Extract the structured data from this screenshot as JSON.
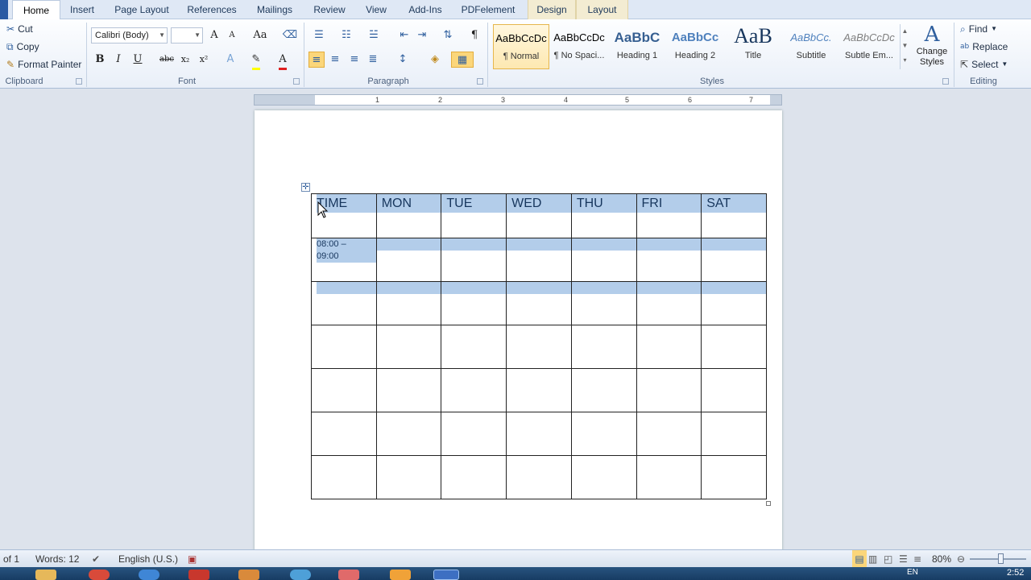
{
  "tabs": [
    "Home",
    "Insert",
    "Page Layout",
    "References",
    "Mailings",
    "Review",
    "View",
    "Add-Ins",
    "PDFelement",
    "Design",
    "Layout"
  ],
  "clipboard": {
    "cut": "Cut",
    "copy": "Copy",
    "format_painter": "Format Painter",
    "label": "Clipboard"
  },
  "font": {
    "name": "Calibri (Body)",
    "size": "",
    "label": "Font",
    "bold": "B",
    "italic": "I",
    "underline": "U",
    "strike": "abc",
    "sub": "x₂",
    "sup": "x²",
    "grow": "A",
    "shrink": "A",
    "case": "Aa"
  },
  "paragraph": {
    "label": "Paragraph",
    "pilcrow": "¶"
  },
  "styles": {
    "label": "Styles",
    "items": [
      {
        "preview": "AaBbCcDc",
        "name": "¶ Normal"
      },
      {
        "preview": "AaBbCcDc",
        "name": "¶ No Spaci..."
      },
      {
        "preview": "AaBbC",
        "name": "Heading 1"
      },
      {
        "preview": "AaBbCc",
        "name": "Heading 2"
      },
      {
        "preview": "AaB",
        "name": "Title"
      },
      {
        "preview": "AaBbCc.",
        "name": "Subtitle"
      },
      {
        "preview": "AaBbCcDc",
        "name": "Subtle Em..."
      }
    ],
    "change_styles_line1": "Change",
    "change_styles_line2": "Styles"
  },
  "editing": {
    "label": "Editing",
    "find": "Find",
    "replace": "Replace",
    "select": "Select"
  },
  "ruler": {
    "numbers": [
      "1",
      "2",
      "3",
      "4",
      "5",
      "6",
      "7"
    ]
  },
  "table": {
    "headers": [
      "TIME",
      "MON",
      "TUE",
      "WED",
      "THU",
      "FRI",
      "SAT"
    ],
    "time_line1": "08:00 –",
    "time_line2": "09:00"
  },
  "status": {
    "page": "of 1",
    "words": "Words: 12",
    "language": "English (U.S.)",
    "zoom": "80%",
    "language_code": "EN",
    "clock": "2:52"
  },
  "colors": {
    "accent": "#2a5aa3",
    "highlight": "#b3cdea",
    "heading_text": "#17365d"
  }
}
